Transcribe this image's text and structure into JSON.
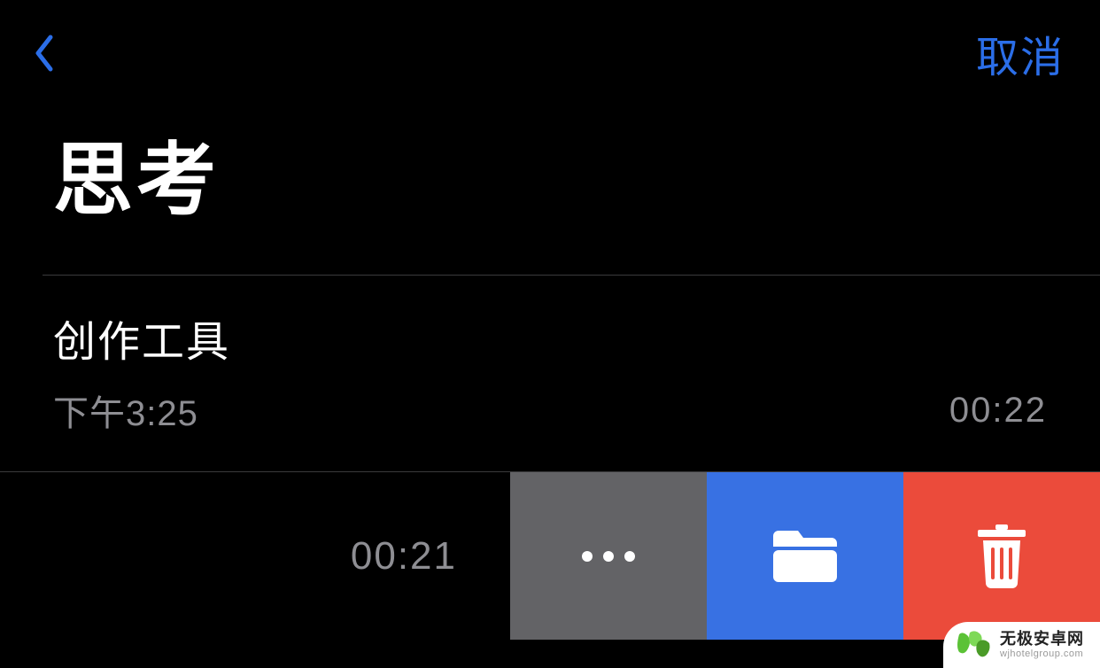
{
  "header": {
    "cancel_label": "取消"
  },
  "folder": {
    "title": "思考"
  },
  "recordings": [
    {
      "title": "创作工具",
      "timestamp": "下午3:25",
      "duration": "00:22"
    }
  ],
  "swiped_row": {
    "duration": "00:21"
  },
  "colors": {
    "accent": "#2b6ee8",
    "more_action": "#636366",
    "folder_action": "#3871e3",
    "delete_action": "#eb4b3b"
  },
  "watermark": {
    "name": "无极安卓网",
    "url": "wjhotelgroup.com"
  }
}
